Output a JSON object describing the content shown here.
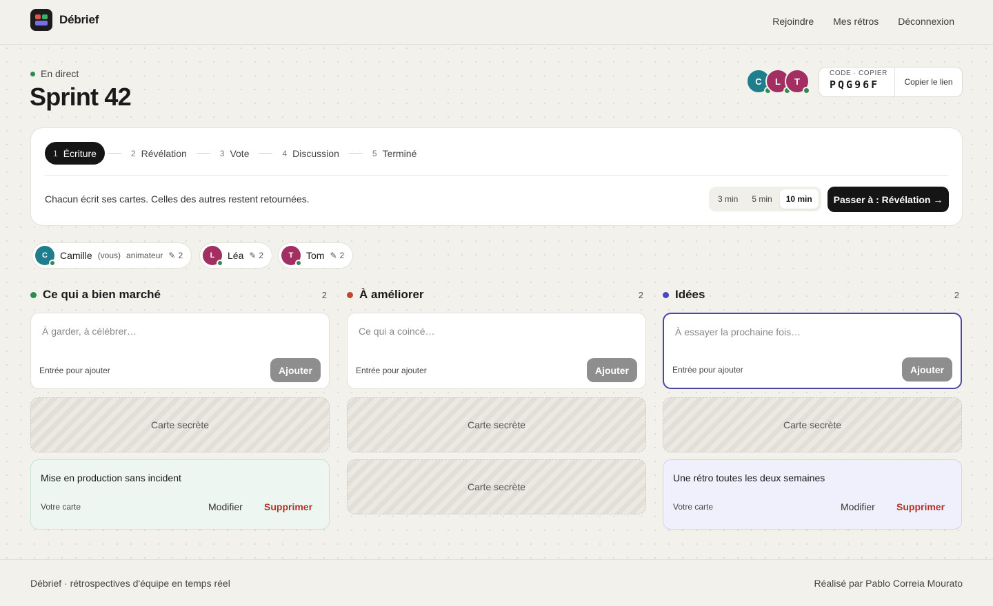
{
  "app": {
    "name": "Débrief"
  },
  "nav": {
    "join": "Rejoindre",
    "my_retros": "Mes rétros",
    "logout": "Déconnexion"
  },
  "session": {
    "status": "En direct",
    "title": "Sprint 42",
    "code_label": "CODE · COPIER",
    "code": "PQG96F",
    "copy_link": "Copier le lien",
    "avatars": [
      {
        "initial": "C",
        "color": "#1e7e8c"
      },
      {
        "initial": "L",
        "color": "#a32e62"
      },
      {
        "initial": "T",
        "color": "#a32e62"
      }
    ]
  },
  "phases": {
    "steps": [
      {
        "num": "1",
        "label": "Écriture"
      },
      {
        "num": "2",
        "label": "Révélation"
      },
      {
        "num": "3",
        "label": "Vote"
      },
      {
        "num": "4",
        "label": "Discussion"
      },
      {
        "num": "5",
        "label": "Terminé"
      }
    ],
    "active_step": "Écriture",
    "hint": "Chacun écrit ses cartes. Celles des autres restent retournées.",
    "timers": [
      "3 min",
      "5 min",
      "10 min"
    ],
    "selected_timer": "10 min",
    "next_button": "Passer à : Révélation →"
  },
  "participants": [
    {
      "initial": "C",
      "name": "Camille",
      "you": "(vous)",
      "role": "animateur",
      "count_icon": "✎",
      "count": "2",
      "color": "#1e7e8c"
    },
    {
      "initial": "L",
      "name": "Léa",
      "count_icon": "✎",
      "count": "2",
      "color": "#a32e62"
    },
    {
      "initial": "T",
      "name": "Tom",
      "count_icon": "✎",
      "count": "2",
      "color": "#a32e62"
    }
  ],
  "columns": [
    {
      "title": "Ce qui a bien marché",
      "count": "2",
      "color": "#2f8a4f",
      "placeholder": "À garder, à célébrer…",
      "enter_hint": "Entrée pour ajouter",
      "add_label": "Ajouter",
      "secret_cards": [
        "Carte secrète"
      ],
      "own_card": {
        "text": "Mise en production sans incident",
        "mine": "Votre carte",
        "edit": "Modifier",
        "delete": "Supprimer"
      }
    },
    {
      "title": "À améliorer",
      "count": "2",
      "color": "#c0462f",
      "placeholder": "Ce qui a coincé…",
      "enter_hint": "Entrée pour ajouter",
      "add_label": "Ajouter",
      "secret_cards": [
        "Carte secrète",
        "Carte secrète"
      ]
    },
    {
      "title": "Idées",
      "count": "2",
      "color": "#4a45c8",
      "placeholder": "À essayer la prochaine fois…",
      "enter_hint": "Entrée pour ajouter",
      "add_label": "Ajouter",
      "secret_cards": [
        "Carte secrète"
      ],
      "own_card": {
        "text": "Une rétro toutes les deux semaines",
        "mine": "Votre carte",
        "edit": "Modifier",
        "delete": "Supprimer"
      }
    }
  ],
  "footer": {
    "left": "Débrief · rétrospectives d'équipe en temps réel",
    "right": "Réalisé par Pablo Correia Mourato"
  }
}
